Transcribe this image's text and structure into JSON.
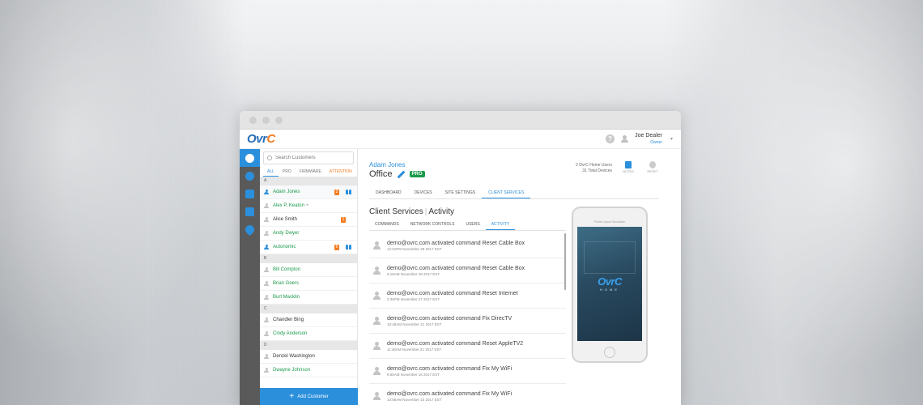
{
  "app": {
    "logo": "OvrC"
  },
  "user": {
    "name": "Joe Dealer",
    "role": "Owner"
  },
  "sidebar_rail": [
    "customers-icon",
    "globe-icon",
    "briefcase-icon",
    "building-icon",
    "location-icon"
  ],
  "customers": {
    "search_placeholder": "Search Customers",
    "filters": [
      "ALL",
      "PRO",
      "FIRMWARE",
      "ATTENTION"
    ],
    "groups": [
      {
        "letter": "A",
        "items": [
          {
            "name": "Adam Jones",
            "badge": "2",
            "group": true,
            "color": "green",
            "blue": true,
            "selected": true
          },
          {
            "name": "Alex P. Keaton",
            "pin": true,
            "color": "green"
          },
          {
            "name": "Alice Smith",
            "badge": "1",
            "color": "dark"
          },
          {
            "name": "Andy Dwyer",
            "color": "green"
          },
          {
            "name": "Autonomic",
            "badge": "6",
            "group": true,
            "color": "green",
            "blue": true
          }
        ]
      },
      {
        "letter": "B",
        "items": [
          {
            "name": "Bill Compton",
            "color": "green"
          },
          {
            "name": "Brian Goers",
            "color": "green"
          },
          {
            "name": "Burt Macklin",
            "color": "green"
          }
        ]
      },
      {
        "letter": "C",
        "items": [
          {
            "name": "Chandler Bing",
            "color": "dark"
          },
          {
            "name": "Cindy Anderson",
            "color": "green"
          }
        ]
      },
      {
        "letter": "D",
        "items": [
          {
            "name": "Denzel Washington",
            "color": "dark"
          },
          {
            "name": "Dwayne Johnson",
            "color": "green"
          }
        ]
      }
    ],
    "add_label": "Add Customer"
  },
  "header": {
    "customer": "Adam Jones",
    "site": "Office",
    "pro_badge": "PRO",
    "stats_line1": "2 OvrC Home Users",
    "stats_line2": "31 Total Devices",
    "notes_label": "NOTES",
    "reset_label": "RESET"
  },
  "tabs": [
    "DASHBOARD",
    "DEVICES",
    "SITE SETTINGS",
    "CLIENT SERVICES"
  ],
  "section": {
    "title": "Client Services",
    "subtitle": "Activity"
  },
  "subtabs": [
    "COMMANDS",
    "NETWORK CONTROLS",
    "USERS",
    "ACTIVITY"
  ],
  "activity": [
    {
      "text": "demo@ovrc.com activated command Reset Cable Box",
      "time": "12:01PM November 28 2017 EST"
    },
    {
      "text": "demo@ovrc.com activated command Reset Cable Box",
      "time": "8:18AM November 28 2017 EST"
    },
    {
      "text": "demo@ovrc.com activated command Reset Internet",
      "time": "2:36PM November 27 2017 EST"
    },
    {
      "text": "demo@ovrc.com activated command Fix DirecTV",
      "time": "10:48AM November 21 2017 EST"
    },
    {
      "text": "demo@ovrc.com activated command Reset AppleTV2",
      "time": "11:46AM November 21 2017 EST"
    },
    {
      "text": "demo@ovrc.com activated command Fix My WiFi",
      "time": "9:55AM November 16 2017 EST"
    },
    {
      "text": "demo@ovrc.com activated command Fix My WiFi",
      "time": "10:58AM November 15 2017 EST"
    }
  ],
  "phone": {
    "label": "Profile Layout Simulation",
    "logo": "OvrC",
    "logo_sub": "HOME"
  },
  "colors": {
    "accent": "#2b8fdc",
    "green": "#1a9a4a",
    "orange": "#f47c20",
    "rail": "#5a5a5a"
  }
}
